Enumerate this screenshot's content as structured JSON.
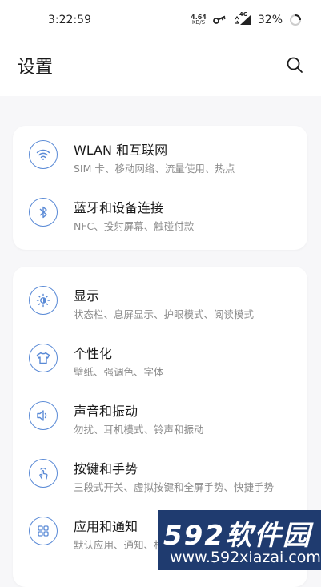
{
  "status_bar": {
    "time": "3:22:59",
    "net_speed_value": "4.64",
    "net_speed_unit": "KB/S",
    "network_type": "4G",
    "battery_percent": "32%"
  },
  "header": {
    "title": "设置"
  },
  "groups": [
    {
      "items": [
        {
          "title": "WLAN 和互联网",
          "subtitle": "SIM 卡、移动网络、流量使用、热点",
          "icon": "wifi-icon"
        },
        {
          "title": "蓝牙和设备连接",
          "subtitle": "NFC、投射屏幕、触碰付款",
          "icon": "bluetooth-icon"
        }
      ]
    },
    {
      "items": [
        {
          "title": "显示",
          "subtitle": "状态栏、息屏显示、护眼模式、阅读模式",
          "icon": "brightness-icon"
        },
        {
          "title": "个性化",
          "subtitle": "壁纸、强调色、字体",
          "icon": "tshirt-icon"
        },
        {
          "title": "声音和振动",
          "subtitle": "勿扰、耳机模式、铃声和振动",
          "icon": "speaker-icon"
        },
        {
          "title": "按键和手势",
          "subtitle": "三段式开关、虚拟按键和全屏手势、快捷手势",
          "icon": "gesture-icon"
        },
        {
          "title": "应用和通知",
          "subtitle": "默认应用、通知、权限",
          "icon": "apps-grid-icon"
        }
      ]
    }
  ],
  "watermark": {
    "logo": "592软件园",
    "url": "www.592xiazai.com"
  },
  "colors": {
    "accent": "#5a8ad6",
    "background": "#f7f7f9",
    "card": "#ffffff"
  }
}
